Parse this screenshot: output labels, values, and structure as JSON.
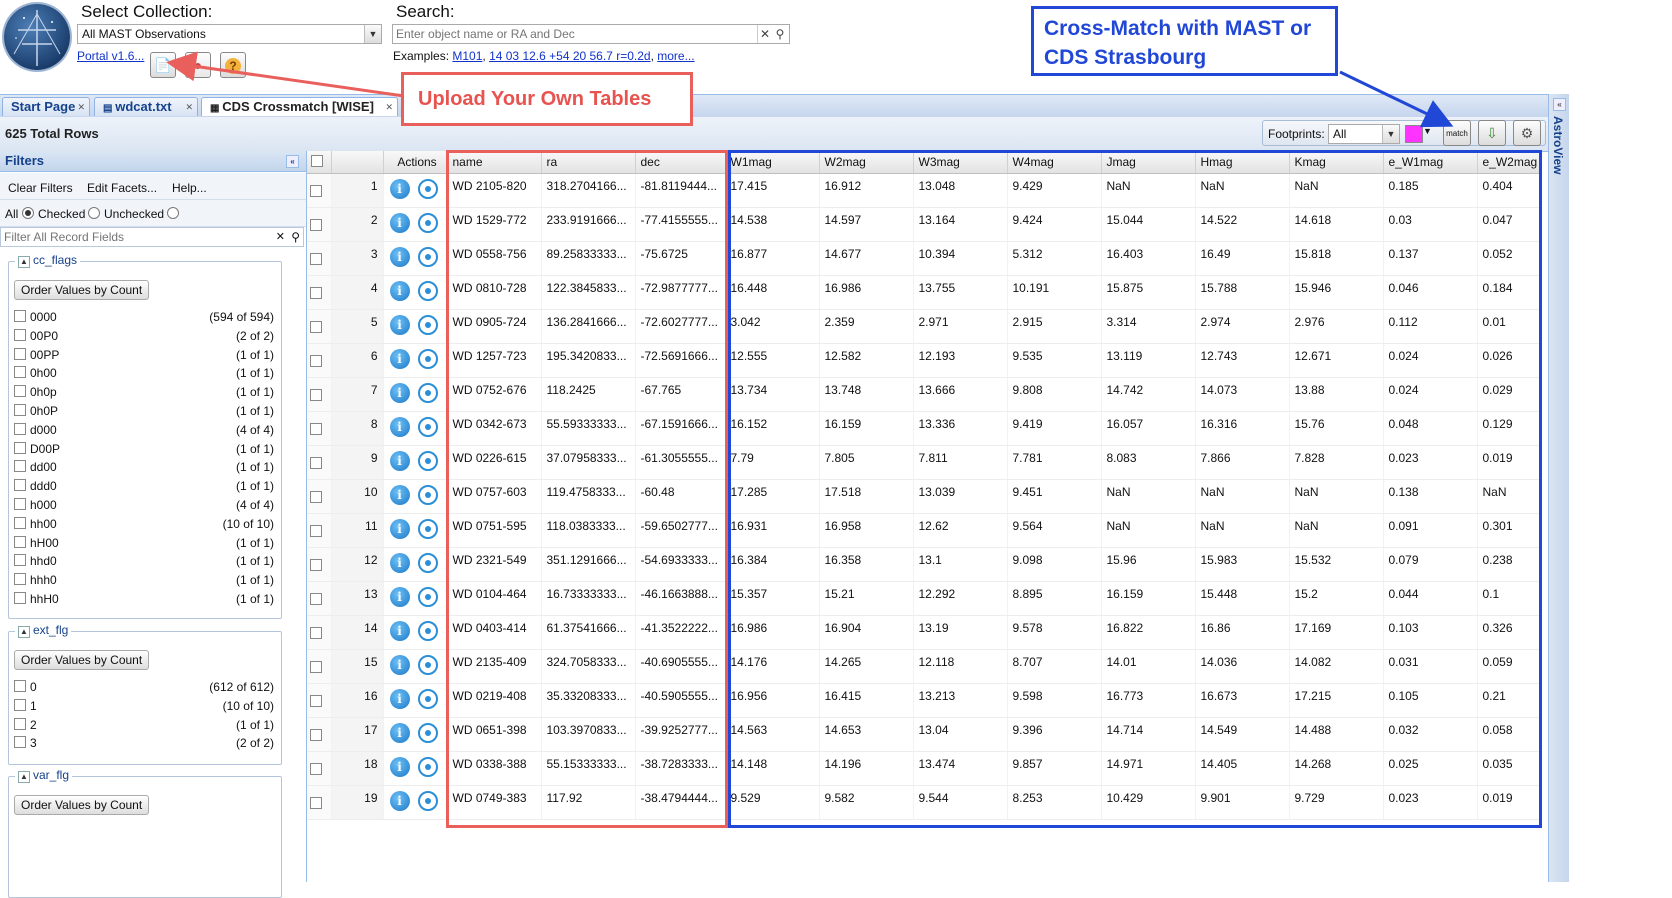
{
  "header": {
    "collection_label": "Select Collection:",
    "collection_value": "All MAST Observations",
    "search_label": "Search:",
    "search_placeholder": "Enter object name or RA and Dec",
    "examples_label": "Examples:",
    "examples": [
      "M101",
      "14 03 12.6 +54 20 56.7 r=0.2d",
      "more..."
    ],
    "portal_version": "Portal v1.6..."
  },
  "tabs": [
    {
      "label": "Start Page"
    },
    {
      "label": "wdcat.txt"
    },
    {
      "label": "CDS Crossmatch [WISE]"
    }
  ],
  "toolbar": {
    "total_rows": "625 Total Rows",
    "footprints_label": "Footprints:",
    "footprints_value": "All",
    "footprint_color": "#ff33ff",
    "match_label": "match"
  },
  "filters": {
    "title": "Filters",
    "links": [
      "Clear Filters",
      "Edit Facets...",
      "Help..."
    ],
    "scope": {
      "all": "All",
      "checked": "Checked",
      "unchecked": "Unchecked"
    },
    "search_placeholder": "Filter All Record Fields",
    "order_label": "Order Values by Count",
    "groups": [
      {
        "name": "cc_flags",
        "items": [
          {
            "v": "0000",
            "c": "(594 of 594)"
          },
          {
            "v": "00P0",
            "c": "(2 of 2)"
          },
          {
            "v": "00PP",
            "c": "(1 of 1)"
          },
          {
            "v": "0h00",
            "c": "(1 of 1)"
          },
          {
            "v": "0h0p",
            "c": "(1 of 1)"
          },
          {
            "v": "0h0P",
            "c": "(1 of 1)"
          },
          {
            "v": "d000",
            "c": "(4 of 4)"
          },
          {
            "v": "D00P",
            "c": "(1 of 1)"
          },
          {
            "v": "dd00",
            "c": "(1 of 1)"
          },
          {
            "v": "ddd0",
            "c": "(1 of 1)"
          },
          {
            "v": "h000",
            "c": "(4 of 4)"
          },
          {
            "v": "hh00",
            "c": "(10 of 10)"
          },
          {
            "v": "hH00",
            "c": "(1 of 1)"
          },
          {
            "v": "hhd0",
            "c": "(1 of 1)"
          },
          {
            "v": "hhh0",
            "c": "(1 of 1)"
          },
          {
            "v": "hhH0",
            "c": "(1 of 1)"
          }
        ]
      },
      {
        "name": "ext_flg",
        "items": [
          {
            "v": "0",
            "c": "(612 of 612)"
          },
          {
            "v": "1",
            "c": "(10 of 10)"
          },
          {
            "v": "2",
            "c": "(1 of 1)"
          },
          {
            "v": "3",
            "c": "(2 of 2)"
          }
        ]
      },
      {
        "name": "var_flg",
        "items": []
      }
    ]
  },
  "grid": {
    "actions_header": "Actions",
    "columns": [
      "name",
      "ra",
      "dec",
      "W1mag",
      "W2mag",
      "W3mag",
      "W4mag",
      "Jmag",
      "Hmag",
      "Kmag",
      "e_W1mag",
      "e_W2mag"
    ],
    "rows": [
      [
        "1",
        "WD 2105-820",
        "318.2704166...",
        "-81.8119444...",
        "17.415",
        "16.912",
        "13.048",
        "9.429",
        "NaN",
        "NaN",
        "NaN",
        "0.185",
        "0.404"
      ],
      [
        "2",
        "WD 1529-772",
        "233.9191666...",
        "-77.4155555...",
        "14.538",
        "14.597",
        "13.164",
        "9.424",
        "15.044",
        "14.522",
        "14.618",
        "0.03",
        "0.047"
      ],
      [
        "3",
        "WD 0558-756",
        "89.25833333...",
        "-75.6725",
        "16.877",
        "14.677",
        "10.394",
        "5.312",
        "16.403",
        "16.49",
        "15.818",
        "0.137",
        "0.052"
      ],
      [
        "4",
        "WD 0810-728",
        "122.3845833...",
        "-72.9877777...",
        "16.448",
        "16.986",
        "13.755",
        "10.191",
        "15.875",
        "15.788",
        "15.946",
        "0.046",
        "0.184"
      ],
      [
        "5",
        "WD 0905-724",
        "136.2841666...",
        "-72.6027777...",
        "3.042",
        "2.359",
        "2.971",
        "2.915",
        "3.314",
        "2.974",
        "2.976",
        "0.112",
        "0.01"
      ],
      [
        "6",
        "WD 1257-723",
        "195.3420833...",
        "-72.5691666...",
        "12.555",
        "12.582",
        "12.193",
        "9.535",
        "13.119",
        "12.743",
        "12.671",
        "0.024",
        "0.026"
      ],
      [
        "7",
        "WD 0752-676",
        "118.2425",
        "-67.765",
        "13.734",
        "13.748",
        "13.666",
        "9.808",
        "14.742",
        "14.073",
        "13.88",
        "0.024",
        "0.029"
      ],
      [
        "8",
        "WD 0342-673",
        "55.59333333...",
        "-67.1591666...",
        "16.152",
        "16.159",
        "13.336",
        "9.419",
        "16.057",
        "16.316",
        "15.76",
        "0.048",
        "0.129"
      ],
      [
        "9",
        "WD 0226-615",
        "37.07958333...",
        "-61.3055555...",
        "7.79",
        "7.805",
        "7.811",
        "7.781",
        "8.083",
        "7.866",
        "7.828",
        "0.023",
        "0.019"
      ],
      [
        "10",
        "WD 0757-603",
        "119.4758333...",
        "-60.48",
        "17.285",
        "17.518",
        "13.039",
        "9.451",
        "NaN",
        "NaN",
        "NaN",
        "0.138",
        "NaN"
      ],
      [
        "11",
        "WD 0751-595",
        "118.0383333...",
        "-59.6502777...",
        "16.931",
        "16.958",
        "12.62",
        "9.564",
        "NaN",
        "NaN",
        "NaN",
        "0.091",
        "0.301"
      ],
      [
        "12",
        "WD 2321-549",
        "351.1291666...",
        "-54.6933333...",
        "16.384",
        "16.358",
        "13.1",
        "9.098",
        "15.96",
        "15.983",
        "15.532",
        "0.079",
        "0.238"
      ],
      [
        "13",
        "WD 0104-464",
        "16.73333333...",
        "-46.1663888...",
        "15.357",
        "15.21",
        "12.292",
        "8.895",
        "16.159",
        "15.448",
        "15.2",
        "0.044",
        "0.1"
      ],
      [
        "14",
        "WD 0403-414",
        "61.37541666...",
        "-41.3522222...",
        "16.986",
        "16.904",
        "13.19",
        "9.578",
        "16.822",
        "16.86",
        "17.169",
        "0.103",
        "0.326"
      ],
      [
        "15",
        "WD 2135-409",
        "324.7058333...",
        "-40.6905555...",
        "14.176",
        "14.265",
        "12.118",
        "8.707",
        "14.01",
        "14.036",
        "14.082",
        "0.031",
        "0.059"
      ],
      [
        "16",
        "WD 0219-408",
        "35.33208333...",
        "-40.5905555...",
        "16.956",
        "16.415",
        "13.213",
        "9.598",
        "16.773",
        "16.673",
        "17.215",
        "0.105",
        "0.21"
      ],
      [
        "17",
        "WD 0651-398",
        "103.3970833...",
        "-39.9252777...",
        "14.563",
        "14.653",
        "13.04",
        "9.396",
        "14.714",
        "14.549",
        "14.488",
        "0.032",
        "0.058"
      ],
      [
        "18",
        "WD 0338-388",
        "55.15333333...",
        "-38.7283333...",
        "14.148",
        "14.196",
        "13.474",
        "9.857",
        "14.971",
        "14.405",
        "14.268",
        "0.025",
        "0.035"
      ],
      [
        "19",
        "WD 0749-383",
        "117.92",
        "-38.4794444...",
        "9.529",
        "9.582",
        "9.544",
        "8.253",
        "10.429",
        "9.901",
        "9.729",
        "0.023",
        "0.019"
      ]
    ]
  },
  "astroview_label": "AstroView",
  "annotations": {
    "upload": "Upload Your Own Tables",
    "crossmatch": "Cross-Match with MAST or CDS Strasbourg",
    "red_color": "#e85f5c",
    "blue_color": "#2147d6"
  }
}
